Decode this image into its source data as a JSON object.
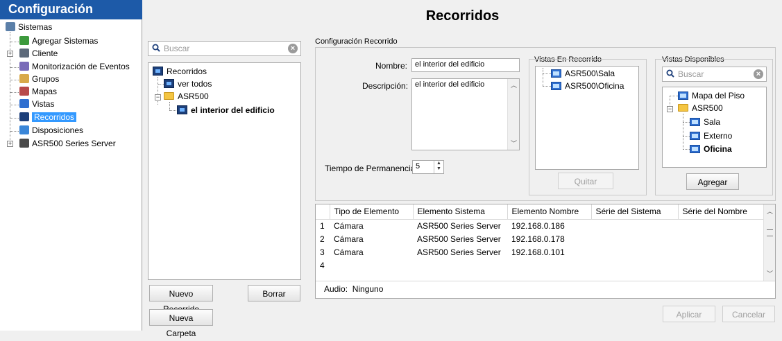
{
  "nav": {
    "title": "Configuración",
    "items": [
      {
        "label": "Sistemas"
      },
      {
        "label": "Agregar Sistemas"
      },
      {
        "label": "Cliente"
      },
      {
        "label": "Monitorización de Eventos"
      },
      {
        "label": "Grupos"
      },
      {
        "label": "Mapas"
      },
      {
        "label": "Vistas"
      },
      {
        "label": "Recorridos"
      },
      {
        "label": "Disposiciones"
      },
      {
        "label": "ASR500 Series Server"
      }
    ],
    "selected": "Recorridos"
  },
  "main": {
    "title": "Recorridos"
  },
  "tours": {
    "search_placeholder": "Buscar",
    "tree": {
      "root": "Recorridos",
      "view_all": "ver todos",
      "folder": "ASR500",
      "selected_tour": "el interior del edificio"
    },
    "new_tour_button": "Nuevo Recorrido",
    "delete_button": "Borrar",
    "new_folder_button": "Nueva Carpeta"
  },
  "config": {
    "group_title": "Configuración Recorrido",
    "name_label": "Nombre:",
    "name_value": "el interior del edificio",
    "description_label": "Descripción:",
    "description_value": "el interior del edificio",
    "dwell_label": "Tiempo de Permanencia:",
    "dwell_value": "5"
  },
  "views_in_tour": {
    "title": "Vistas En Recorrido",
    "items": [
      "ASR500\\Sala",
      "ASR500\\Oficina"
    ],
    "remove_button": "Quitar"
  },
  "available_views": {
    "title": "Vistas Disponibles",
    "search_placeholder": "Buscar",
    "tree": {
      "floor_map": "Mapa del Piso",
      "folder": "ASR500",
      "items": [
        "Sala",
        "Externo",
        "Oficina"
      ],
      "selected": "Oficina"
    },
    "add_button": "Agregar"
  },
  "elements_table": {
    "columns": [
      "Tipo de Elemento",
      "Elemento Sistema",
      "Elemento Nombre",
      "Série del Sistema",
      "Série del Nombre"
    ],
    "rows": [
      {
        "n": "1",
        "type": "Cámara",
        "system": "ASR500 Series Server",
        "name": "192.168.0.186",
        "sys_serial": "",
        "name_serial": ""
      },
      {
        "n": "2",
        "type": "Cámara",
        "system": "ASR500 Series Server",
        "name": "192.168.0.178",
        "sys_serial": "",
        "name_serial": ""
      },
      {
        "n": "3",
        "type": "Cámara",
        "system": "ASR500 Series Server",
        "name": "192.168.0.101",
        "sys_serial": "",
        "name_serial": ""
      },
      {
        "n": "4",
        "type": "",
        "system": "",
        "name": "",
        "sys_serial": "",
        "name_serial": ""
      }
    ],
    "audio_label": "Audio:",
    "audio_value": "Ninguno"
  },
  "footer": {
    "apply_button": "Aplicar",
    "cancel_button": "Cancelar"
  },
  "colors": {
    "nav_header": "#1d5aa8",
    "selection": "#3399ff"
  }
}
